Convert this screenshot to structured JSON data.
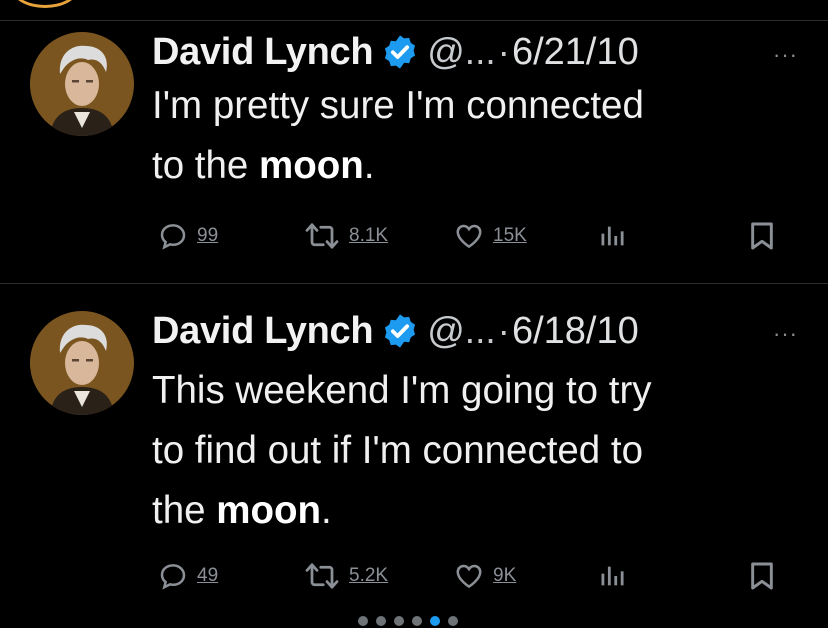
{
  "colors": {
    "accent": "#1d9bf0",
    "background": "#000000",
    "muted": "#8b9096",
    "ring": "#e8a33a"
  },
  "icons": {
    "reply": "reply-icon",
    "retweet": "retweet-icon",
    "like": "heart-icon",
    "views": "views-icon",
    "bookmark": "bookmark-icon",
    "verified": "verified-badge-icon",
    "more": "more-icon"
  },
  "tweets": [
    {
      "name": "David Lynch",
      "handle": "@...",
      "separator": "·",
      "date": "6/21/10",
      "more": "···",
      "text_line1": "I'm pretty sure I'm connected",
      "text_line2_pre": "to the ",
      "text_line2_bold": "moon",
      "text_line2_post": ".",
      "replies": "99",
      "retweets": "8.1K",
      "likes": "15K"
    },
    {
      "name": "David Lynch",
      "handle": "@...",
      "separator": "·",
      "date": "6/18/10",
      "more": "···",
      "text_line1": "This weekend I'm going to try",
      "text_line2": "to find out if I'm connected to",
      "text_line3_pre": "the ",
      "text_line3_bold": "moon",
      "text_line3_post": ".",
      "replies": "49",
      "retweets": "5.2K",
      "likes": "9K"
    }
  ]
}
